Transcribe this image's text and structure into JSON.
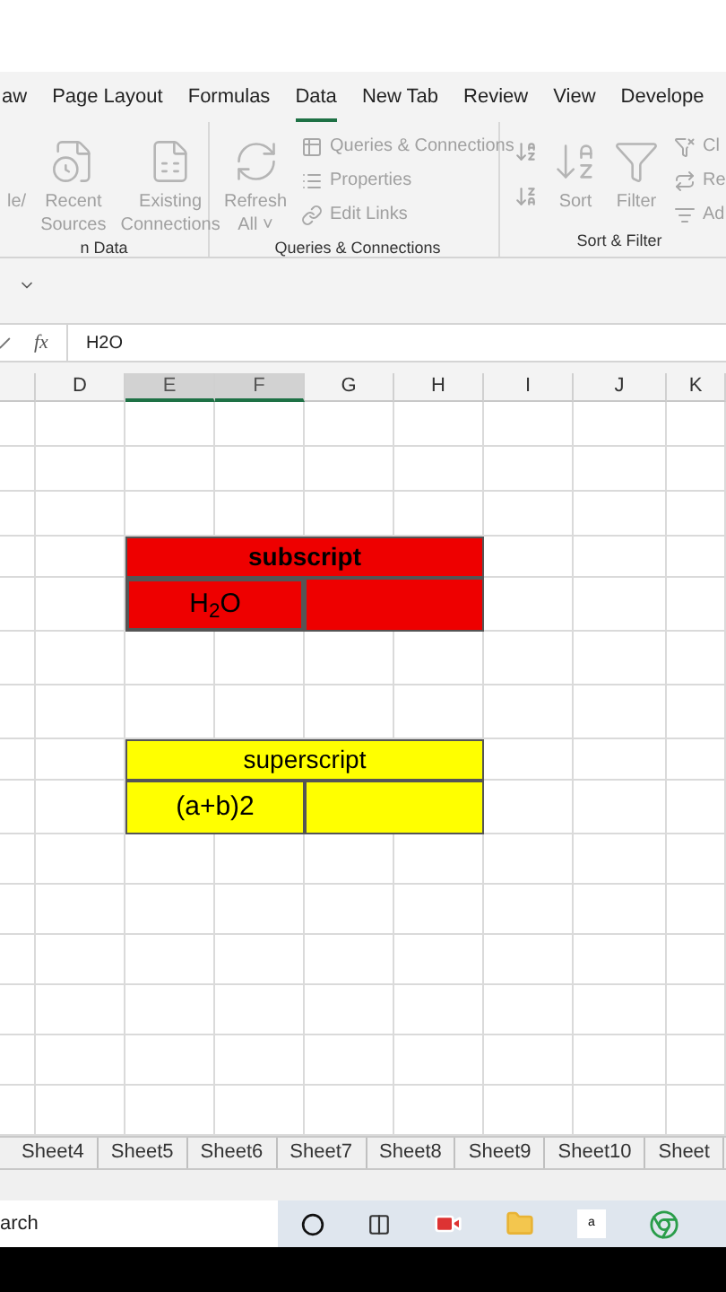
{
  "ribbon_tabs": [
    {
      "label": "aw",
      "selected": false
    },
    {
      "label": "Page Layout",
      "selected": false
    },
    {
      "label": "Formulas",
      "selected": false
    },
    {
      "label": "Data",
      "selected": true
    },
    {
      "label": "New Tab",
      "selected": false
    },
    {
      "label": "Review",
      "selected": false
    },
    {
      "label": "View",
      "selected": false
    },
    {
      "label": "Develope",
      "selected": false
    }
  ],
  "ribbon_groups": [
    {
      "label": "n Data",
      "items": [
        {
          "kind": "large",
          "lines": [
            "le/"
          ]
        },
        {
          "kind": "large",
          "lines": [
            "Recent",
            "Sources"
          ]
        },
        {
          "kind": "large",
          "lines": [
            "Existing",
            "Connections"
          ]
        }
      ]
    },
    {
      "label": "Queries & Connections",
      "items": [
        {
          "kind": "large",
          "lines": [
            "Refresh",
            "All ˅"
          ]
        },
        {
          "kind": "small",
          "entries": [
            "Queries & Connections",
            "Properties",
            "Edit Links"
          ]
        }
      ]
    },
    {
      "label": "Sort & Filter",
      "items": [
        {
          "kind": "sorticons"
        },
        {
          "kind": "large",
          "lines": [
            "Sort"
          ]
        },
        {
          "kind": "large",
          "lines": [
            "Filter"
          ]
        },
        {
          "kind": "small",
          "entries": [
            "Cl",
            "Re",
            "Ad"
          ]
        }
      ]
    }
  ],
  "formula_bar": {
    "fx": "fx",
    "value": "H2O"
  },
  "columns": [
    {
      "selected": false
    },
    {
      "label": "D",
      "selected": false
    },
    {
      "label": "E",
      "selected": true
    },
    {
      "label": "F",
      "selected": true
    },
    {
      "label": "G",
      "selected": false
    },
    {
      "label": "H",
      "selected": false
    },
    {
      "label": "I",
      "selected": false
    },
    {
      "label": "J",
      "selected": false
    },
    {
      "label": "K",
      "selected": false
    }
  ],
  "tables": [
    {
      "color": "#ee0000",
      "header": "subscript",
      "header_bold": true,
      "value": "H$_{2}$O",
      "selected": true
    },
    {
      "color": "#ffff00",
      "header": "superscript",
      "header_bold": false,
      "value": "(a+b)2",
      "selected": false
    }
  ],
  "sheet_tabs": [
    "Sheet4",
    "Sheet5",
    "Sheet6",
    "Sheet7",
    "Sheet8",
    "Sheet9",
    "Sheet10",
    "Sheet"
  ],
  "taskbar": {
    "search": "arch",
    "tile_letter": "a"
  }
}
